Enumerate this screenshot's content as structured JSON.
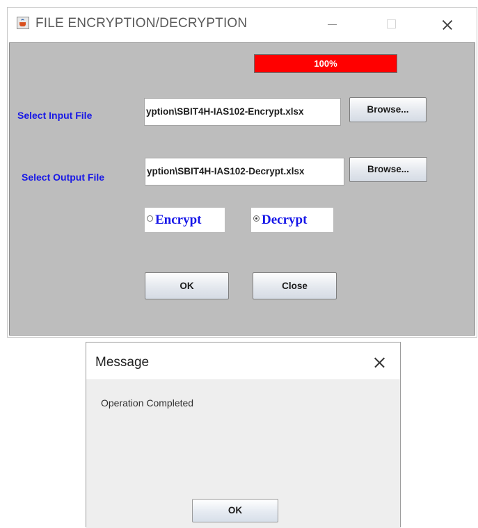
{
  "window": {
    "title": "FILE ENCRYPTION/DECRYPTION",
    "icon": "java-cup-icon"
  },
  "progress": {
    "value_percent": 100,
    "text": "100%",
    "fill_color": "#ff0000"
  },
  "input_row": {
    "label": "Select Input  File",
    "path_value": "yption\\SBIT4H-IAS102-Encrypt.xlsx",
    "browse_label": "Browse..."
  },
  "output_row": {
    "label": "Select Output File",
    "path_value": "yption\\SBIT4H-IAS102-Decrypt.xlsx",
    "browse_label": "Browse..."
  },
  "mode": {
    "options": [
      {
        "label": "Encrypt",
        "selected": false
      },
      {
        "label": "Decrypt",
        "selected": true
      }
    ]
  },
  "buttons": {
    "ok": "OK",
    "close": "Close"
  },
  "dialog": {
    "title": "Message",
    "message": "Operation Completed",
    "ok": "OK"
  },
  "colors": {
    "label_blue": "#1818e6",
    "panel_gray": "#bdbdbd",
    "radio_text_blue": "#1515e8"
  }
}
